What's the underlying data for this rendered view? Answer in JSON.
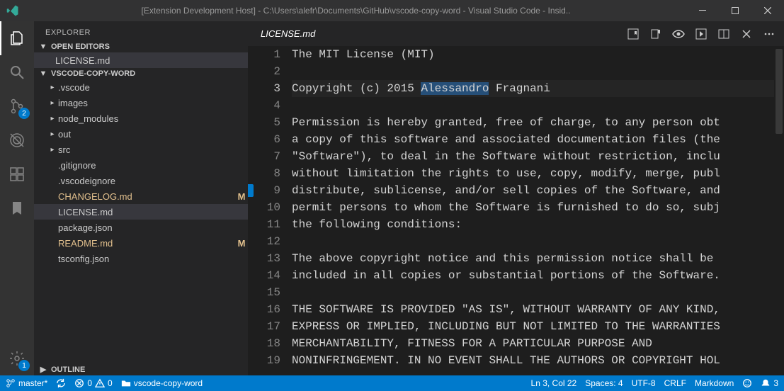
{
  "titlebar": {
    "title": "[Extension Development Host] - C:\\Users\\alefr\\Documents\\GitHub\\vscode-copy-word - Visual Studio Code - Insid.."
  },
  "sidebar": {
    "title": "EXPLORER",
    "sections": {
      "openEditors": {
        "label": "OPEN EDITORS",
        "items": [
          {
            "label": "LICENSE.md",
            "selected": true
          }
        ]
      },
      "folder": {
        "label": "VSCODE-COPY-WORD",
        "items": [
          {
            "label": ".vscode",
            "type": "folder"
          },
          {
            "label": "images",
            "type": "folder"
          },
          {
            "label": "node_modules",
            "type": "folder"
          },
          {
            "label": "out",
            "type": "folder"
          },
          {
            "label": "src",
            "type": "folder"
          },
          {
            "label": ".gitignore",
            "type": "file"
          },
          {
            "label": ".vscodeignore",
            "type": "file"
          },
          {
            "label": "CHANGELOG.md",
            "type": "file",
            "status": "M",
            "modified": true
          },
          {
            "label": "LICENSE.md",
            "type": "file",
            "selected": true
          },
          {
            "label": "package.json",
            "type": "file"
          },
          {
            "label": "README.md",
            "type": "file",
            "status": "M",
            "modified": true
          },
          {
            "label": "tsconfig.json",
            "type": "file"
          }
        ]
      },
      "outline": {
        "label": "OUTLINE"
      }
    }
  },
  "activitybar": {
    "scm_badge": "2",
    "settings_badge": "1"
  },
  "editor": {
    "tab": "LICENSE.md",
    "active_line": 3,
    "bookmark_line": 9,
    "selection_line": 3,
    "selection_text": "Alessandro",
    "lines": [
      "The MIT License (MIT)",
      "",
      "Copyright (c) 2015 Alessandro Fragnani",
      "",
      "Permission is hereby granted, free of charge, to any person obt",
      "a copy of this software and associated documentation files (the",
      "\"Software\"), to deal in the Software without restriction, inclu",
      "without limitation the rights to use, copy, modify, merge, publ",
      "distribute, sublicense, and/or sell copies of the Software, and",
      "permit persons to whom the Software is furnished to do so, subj",
      "the following conditions:",
      "",
      "The above copyright notice and this permission notice shall be",
      "included in all copies or substantial portions of the Software.",
      "",
      "THE SOFTWARE IS PROVIDED \"AS IS\", WITHOUT WARRANTY OF ANY KIND,",
      "EXPRESS OR IMPLIED, INCLUDING BUT NOT LIMITED TO THE WARRANTIES",
      "MERCHANTABILITY, FITNESS FOR A PARTICULAR PURPOSE AND",
      "NONINFRINGEMENT. IN NO EVENT SHALL THE AUTHORS OR COPYRIGHT HOL"
    ]
  },
  "statusbar": {
    "branch": "master*",
    "sync": "",
    "errors": "0",
    "warnings": "0",
    "path": "vscode-copy-word",
    "cursor": "Ln 3, Col 22",
    "spaces": "Spaces: 4",
    "encoding": "UTF-8",
    "eol": "CRLF",
    "lang": "Markdown",
    "notifications": "3"
  }
}
